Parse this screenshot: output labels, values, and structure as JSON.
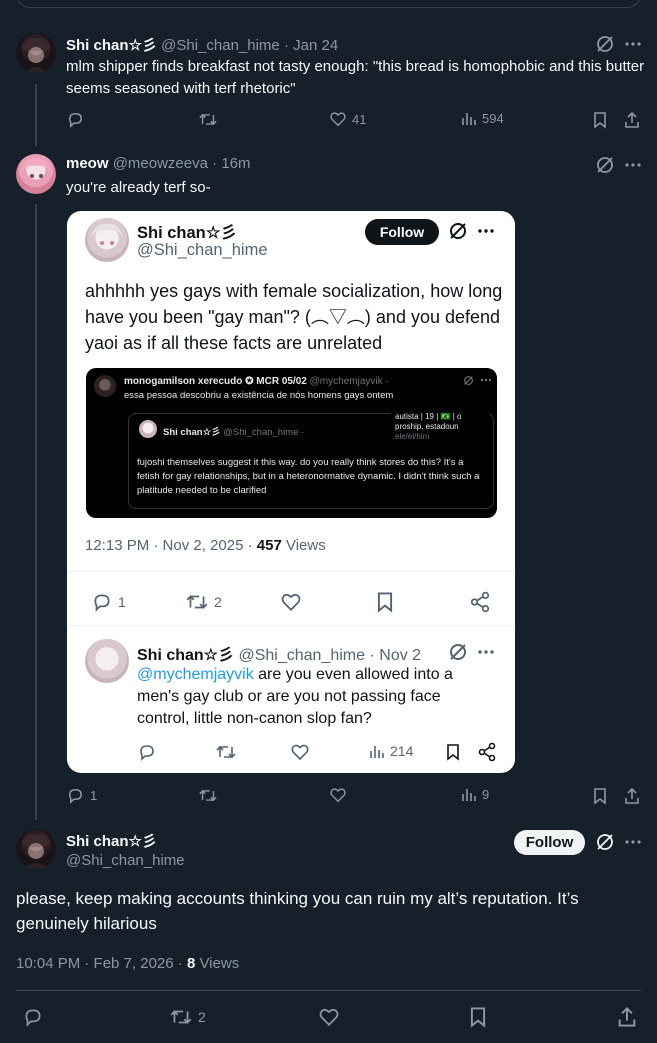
{
  "tweet1": {
    "name": "Shi chan☆彡",
    "handle": "@Shi_chan_hime",
    "sep": "·",
    "date": "Jan 24",
    "text": "mlm shipper finds breakfast not tasty enough: \"this bread is homophobic and this butter seems seasoned with terf rhetoric\"",
    "likes": "41",
    "views": "594"
  },
  "tweet2": {
    "name": "meow",
    "handle": "@meowzeeva",
    "sep": "·",
    "time": "16m",
    "text": "you're already terf so-",
    "replies": "1",
    "views": "9"
  },
  "card": {
    "name": "Shi chan☆彡",
    "handle": "@Shi_chan_hime",
    "follow": "Follow",
    "text": "ahhhhh yes gays with female socialization, how long have you been \"gay man\"? (︵▽︵) and you defend yaoi as if all these facts are unrelated",
    "timestamp": "12:13 PM · Nov 2, 2025 ·",
    "views_count": "457",
    "views_label": "Views",
    "replies": "1",
    "reposts": "2",
    "embed": {
      "name": "monogamilson xerecudo ✪ MCR 05/02",
      "handle": "@mychemjayvik ·",
      "text": "essa pessoa descobriu a existência de nós homens gays ontem",
      "inner_name": "Shi chan☆彡",
      "inner_handle": "@Shi_chan_hime ·",
      "bio1": "autista | 19 | 🇧🇷 | o",
      "bio2": "proship, estadoun",
      "pronouns": "ele/el/him",
      "inner_text": "fujoshi themselves suggest it this way. do you really think stores do this? It's a fetish for gay relationships, but in a heteronormative dynamic. I didn't think such a platitude needed to be clarified"
    },
    "reply": {
      "name": "Shi chan☆彡",
      "handle": "@Shi_chan_hime",
      "sep": "·",
      "date": "Nov 2",
      "mention": "@mychemjayvik",
      "text": " are you even allowed into a men's gay club or are you not passing face control, little non-canon slop fan?",
      "views": "214"
    }
  },
  "main": {
    "name": "Shi chan☆彡",
    "handle": "@Shi_chan_hime",
    "follow": "Follow",
    "text": "please, keep making accounts thinking you can ruin my alt’s reputation. It’s genuinely hilarious",
    "timestamp": "10:04 PM · Feb 7, 2026 ·",
    "views_count": "8",
    "views_label": "Views",
    "reposts": "2"
  },
  "colors": {
    "background": "#15202b",
    "muted": "#8b98a5",
    "link": "#1d9bf0",
    "border": "#38444d"
  },
  "icons": [
    "grok-icon",
    "more-icon",
    "reply-icon",
    "repost-icon",
    "like-icon",
    "views-icon",
    "bookmark-icon",
    "share-icon"
  ]
}
